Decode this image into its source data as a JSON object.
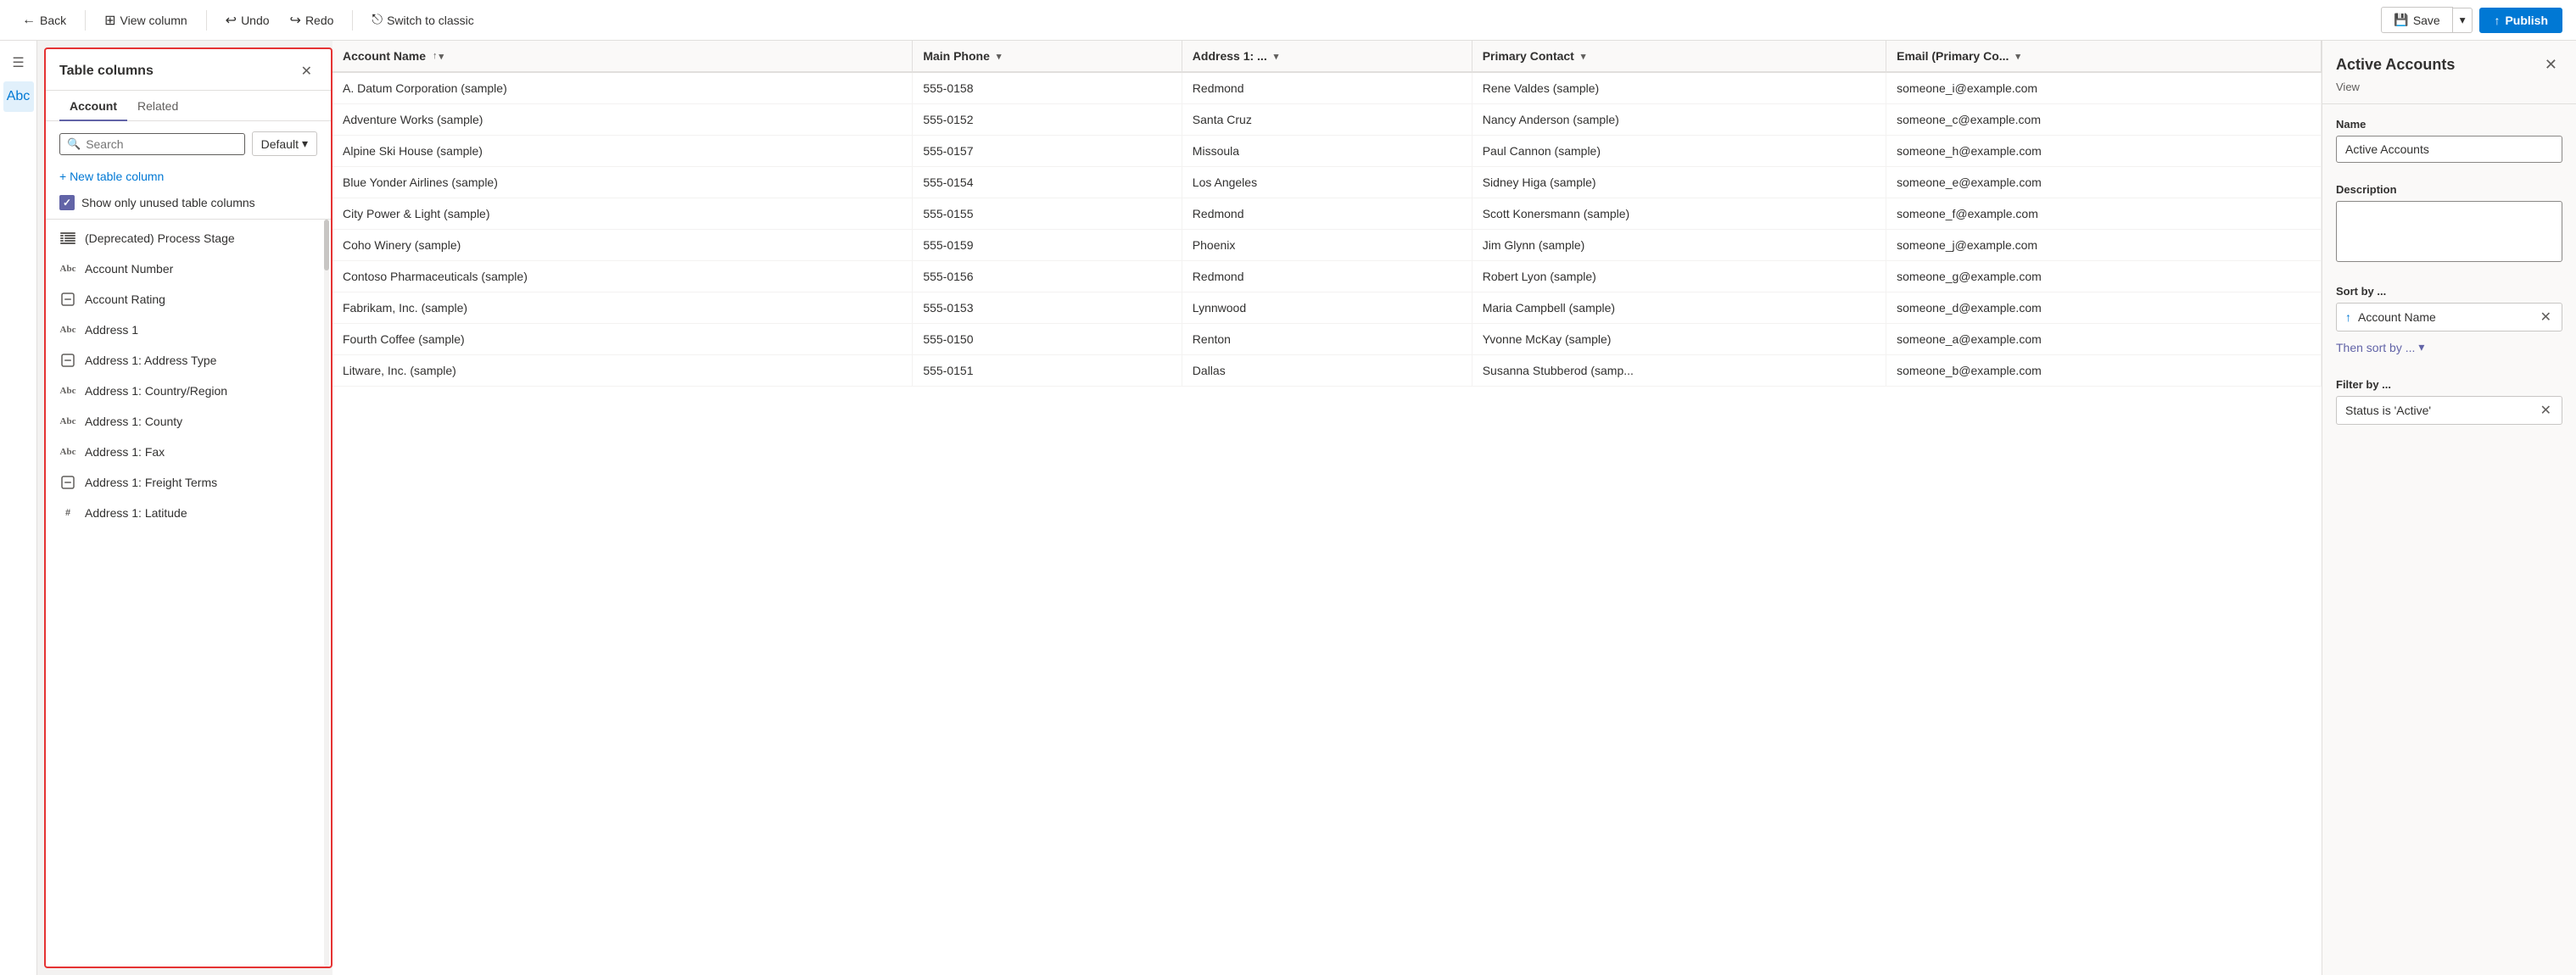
{
  "toolbar": {
    "back_label": "Back",
    "view_column_label": "View column",
    "undo_label": "Undo",
    "redo_label": "Redo",
    "switch_classic_label": "Switch to classic",
    "save_label": "Save",
    "publish_label": "Publish"
  },
  "columns_panel": {
    "title": "Table columns",
    "close_icon": "✕",
    "tab_account": "Account",
    "tab_related": "Related",
    "search_placeholder": "Search",
    "default_dropdown": "Default",
    "new_column_label": "+ New table column",
    "show_unused_label": "Show only unused table columns",
    "columns": [
      {
        "icon": "≡≡",
        "label": "(Deprecated) Process Stage",
        "type": "list"
      },
      {
        "icon": "Abc",
        "label": "Account Number",
        "type": "text"
      },
      {
        "icon": "⊟",
        "label": "Account Rating",
        "type": "dropdown"
      },
      {
        "icon": "Abc",
        "label": "Address 1",
        "type": "text"
      },
      {
        "icon": "⊟",
        "label": "Address 1: Address Type",
        "type": "dropdown"
      },
      {
        "icon": "Abc",
        "label": "Address 1: Country/Region",
        "type": "text"
      },
      {
        "icon": "Abc",
        "label": "Address 1: County",
        "type": "text"
      },
      {
        "icon": "Abc",
        "label": "Address 1: Fax",
        "type": "text"
      },
      {
        "icon": "⊟",
        "label": "Address 1: Freight Terms",
        "type": "dropdown"
      },
      {
        "icon": "##",
        "label": "Address 1: Latitude",
        "type": "number"
      }
    ]
  },
  "data_table": {
    "columns": [
      {
        "label": "Account Name",
        "sortable": true,
        "has_filter": true
      },
      {
        "label": "Main Phone",
        "sortable": false,
        "has_filter": true
      },
      {
        "label": "Address 1: ...",
        "sortable": false,
        "has_filter": true
      },
      {
        "label": "Primary Contact",
        "sortable": false,
        "has_filter": true
      },
      {
        "label": "Email (Primary Co...",
        "sortable": false,
        "has_filter": true
      }
    ],
    "rows": [
      {
        "account": "A. Datum Corporation (sample)",
        "phone": "555-0158",
        "address": "Redmond",
        "contact": "Rene Valdes (sample)",
        "email": "someone_i@example.com"
      },
      {
        "account": "Adventure Works (sample)",
        "phone": "555-0152",
        "address": "Santa Cruz",
        "contact": "Nancy Anderson (sample)",
        "email": "someone_c@example.com"
      },
      {
        "account": "Alpine Ski House (sample)",
        "phone": "555-0157",
        "address": "Missoula",
        "contact": "Paul Cannon (sample)",
        "email": "someone_h@example.com"
      },
      {
        "account": "Blue Yonder Airlines (sample)",
        "phone": "555-0154",
        "address": "Los Angeles",
        "contact": "Sidney Higa (sample)",
        "email": "someone_e@example.com"
      },
      {
        "account": "City Power & Light (sample)",
        "phone": "555-0155",
        "address": "Redmond",
        "contact": "Scott Konersmann (sample)",
        "email": "someone_f@example.com"
      },
      {
        "account": "Coho Winery (sample)",
        "phone": "555-0159",
        "address": "Phoenix",
        "contact": "Jim Glynn (sample)",
        "email": "someone_j@example.com"
      },
      {
        "account": "Contoso Pharmaceuticals (sample)",
        "phone": "555-0156",
        "address": "Redmond",
        "contact": "Robert Lyon (sample)",
        "email": "someone_g@example.com"
      },
      {
        "account": "Fabrikam, Inc. (sample)",
        "phone": "555-0153",
        "address": "Lynnwood",
        "contact": "Maria Campbell (sample)",
        "email": "someone_d@example.com"
      },
      {
        "account": "Fourth Coffee (sample)",
        "phone": "555-0150",
        "address": "Renton",
        "contact": "Yvonne McKay (sample)",
        "email": "someone_a@example.com"
      },
      {
        "account": "Litware, Inc. (sample)",
        "phone": "555-0151",
        "address": "Dallas",
        "contact": "Susanna Stubberod (samp...",
        "email": "someone_b@example.com"
      }
    ]
  },
  "right_panel": {
    "title": "Active Accounts",
    "view_label": "View",
    "close_icon": "✕",
    "name_label": "Name",
    "name_value": "Active Accounts",
    "description_label": "Description",
    "description_value": "",
    "sort_label": "Sort by ...",
    "sort_item": "Account Name",
    "sort_icon": "↑",
    "then_sort_label": "Then sort by ...",
    "filter_label": "Filter by ...",
    "filter_item": "Status is 'Active'"
  },
  "colors": {
    "accent": "#6264a7",
    "blue": "#0078d4",
    "border": "#e1dfdd",
    "panel_border": "#e53333"
  }
}
